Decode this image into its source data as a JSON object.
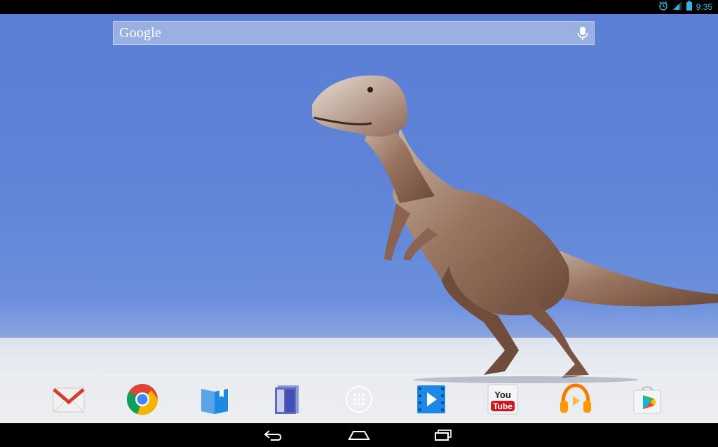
{
  "status_bar": {
    "time": "9:35",
    "icons": [
      "alarm-icon",
      "signal-icon",
      "battery-icon"
    ],
    "accent_color": "#33b5e5"
  },
  "search": {
    "logo_text": "Google",
    "mic_icon": "microphone-icon"
  },
  "wallpaper": {
    "sky_color": "#5d82d6",
    "ground_color": "#e6e8ec",
    "subject": "dinosaur"
  },
  "dock": {
    "apps": [
      {
        "name": "Gmail",
        "icon": "gmail-icon"
      },
      {
        "name": "Chrome",
        "icon": "chrome-icon"
      },
      {
        "name": "Play Books",
        "icon": "play-books-icon"
      },
      {
        "name": "Play Magazines",
        "icon": "play-magazines-icon"
      },
      {
        "name": "Apps",
        "icon": "app-drawer-icon"
      },
      {
        "name": "Play Movies",
        "icon": "play-movies-icon"
      },
      {
        "name": "YouTube",
        "icon": "youtube-icon",
        "logo_you": "You",
        "logo_tube": "Tube"
      },
      {
        "name": "Play Music",
        "icon": "play-music-icon"
      },
      {
        "name": "Play Store",
        "icon": "play-store-icon"
      }
    ]
  },
  "nav": {
    "buttons": [
      "back-icon",
      "home-icon",
      "recents-icon"
    ]
  }
}
